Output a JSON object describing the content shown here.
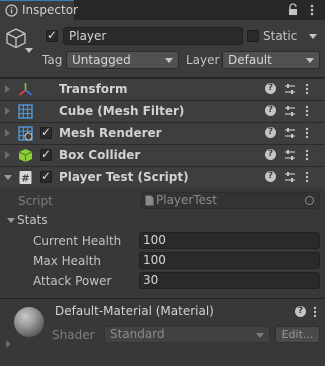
{
  "tab": {
    "title": "Inspector",
    "icon": "info-icon"
  },
  "gameobject": {
    "active": true,
    "name": "Player",
    "static_label": "Static",
    "static": false,
    "tag_label": "Tag",
    "tag_value": "Untagged",
    "layer_label": "Layer",
    "layer_value": "Default",
    "icon": "cube-icon"
  },
  "components": [
    {
      "label": "Transform",
      "icon": "transform-icon",
      "has_checkbox": false,
      "expanded": false
    },
    {
      "label": "Cube (Mesh Filter)",
      "icon": "mesh-filter-icon",
      "has_checkbox": false,
      "expanded": false
    },
    {
      "label": "Mesh Renderer",
      "icon": "mesh-renderer-icon",
      "has_checkbox": true,
      "checked": true,
      "expanded": false
    },
    {
      "label": "Box Collider",
      "icon": "box-collider-icon",
      "has_checkbox": true,
      "checked": true,
      "expanded": false
    },
    {
      "label": "Player Test (Script)",
      "icon": "script-icon",
      "has_checkbox": true,
      "checked": true,
      "expanded": true
    }
  ],
  "script": {
    "label": "Script",
    "value": "PlayerTest",
    "stats_label": "Stats",
    "properties": [
      {
        "label": "Current Health",
        "value": "100"
      },
      {
        "label": "Max Health",
        "value": "100"
      },
      {
        "label": "Attack Power",
        "value": "30"
      }
    ]
  },
  "material": {
    "title": "Default-Material (Material)",
    "shader_label": "Shader",
    "shader_value": "Standard",
    "edit_label": "Edit..."
  },
  "colors": {
    "background": "#383838",
    "tab_accent": "#3a79bb",
    "header_bg": "#3c3c3c",
    "field_bg": "#2a2a2a",
    "transform_x": "#e8493f",
    "transform_y": "#7ccf3a",
    "transform_z": "#3f7ce8",
    "mesh_blue": "#4fa0e8",
    "collider_green": "#8ccf38"
  }
}
